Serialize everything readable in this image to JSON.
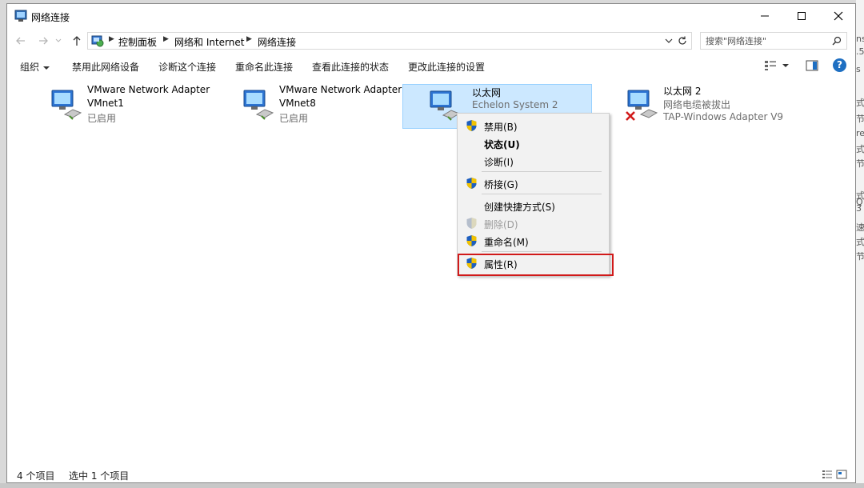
{
  "window": {
    "title": "网络连接"
  },
  "breadcrumb": [
    "控制面板",
    "网络和 Internet",
    "网络连接"
  ],
  "search": {
    "placeholder": "搜索\"网络连接\""
  },
  "commands": {
    "organize": "组织",
    "disable": "禁用此网络设备",
    "diagnose": "诊断这个连接",
    "rename": "重命名此连接",
    "status": "查看此连接的状态",
    "settings": "更改此连接的设置"
  },
  "adapters": [
    {
      "name": "VMware Network Adapter",
      "line2": "VMnet1",
      "line3": "已启用"
    },
    {
      "name": "VMware Network Adapter",
      "line2": "VMnet8",
      "line3": "已启用"
    },
    {
      "name": "以太网",
      "line2": "Echelon System  2",
      "line3": ""
    },
    {
      "name": "以太网 2",
      "line2": "网络电缆被拔出",
      "line3": "TAP-Windows Adapter V9"
    }
  ],
  "context_menu": {
    "items": [
      {
        "label": "禁用(B)",
        "shield": true
      },
      {
        "label": "状态(U)",
        "shield": false,
        "bold": true
      },
      {
        "label": "诊断(I)",
        "shield": false
      },
      {
        "label": "桥接(G)",
        "shield": true
      },
      {
        "label": "创建快捷方式(S)",
        "shield": false
      },
      {
        "label": "删除(D)",
        "shield": true,
        "disabled": true
      },
      {
        "label": "重命名(M)",
        "shield": true
      },
      {
        "label": "属性(R)",
        "shield": true,
        "highlighted": true
      }
    ]
  },
  "statusbar": {
    "count": "4 个项目",
    "selected": "选中 1 个项目"
  },
  "colors": {
    "selection": "#cce8ff",
    "highlight_box": "#d11a1a",
    "help_blue": "#1e6fc2"
  }
}
